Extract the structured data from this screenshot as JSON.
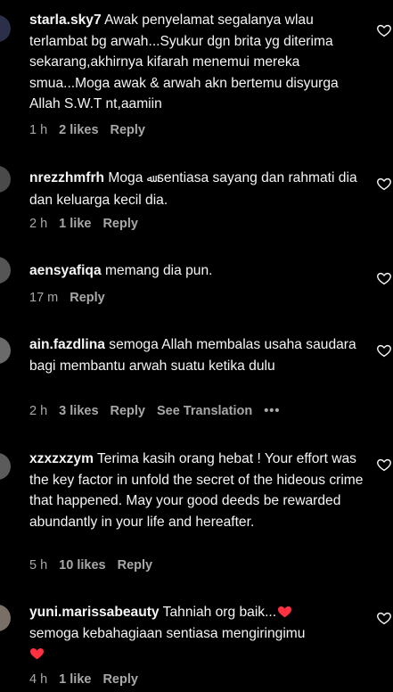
{
  "comments": [
    {
      "username": "starla.sky7",
      "text": "Awak penyelamat segalanya wlau terlambat bg arwah...Syukur dgn brita yg diterima sekarang,akhirnya kifarah menemui mereka smua...Moga awak & arwah akn bertemu disyurga Allah S.W.T nt,aamiin",
      "time": "1 h",
      "likes": "2 likes",
      "reply": "Reply"
    },
    {
      "username": "nrezzhmfrh",
      "text_before": "Moga ",
      "allah_glyph": "ﷲ",
      "text_after": " sentiasa sayang dan rahmati dia dan keluarga kecil dia.",
      "time": "2 h",
      "likes": "1 like",
      "reply": "Reply"
    },
    {
      "username": "aensyafiqa",
      "text": "memang dia pun.",
      "time": "17 m",
      "reply": "Reply"
    },
    {
      "username": "ain.fazdlina",
      "text": "semoga Allah membalas usaha saudara bagi membantu arwah suatu ketika dulu",
      "time": "2 h",
      "likes": "3 likes",
      "reply": "Reply",
      "see_translation": "See Translation",
      "more": "•••"
    },
    {
      "username": "xzxzxzym",
      "text": "Terima kasih orang hebat ! Your effort was the key factor in unfold the secret of the hideous crime that happened. May your good deeds be rewarded abundantly in your life and hereafter.",
      "time": "5 h",
      "likes": "10 likes",
      "reply": "Reply"
    },
    {
      "username": "yuni.marissabeauty",
      "text_before": "Tahniah org baik...",
      "text_middle": "semoga kebahagiaan sentiasa mengiringimu",
      "time": "4 h",
      "likes": "1 like",
      "reply": "Reply"
    }
  ],
  "colors": {
    "background": "#000000",
    "text": "#f5f5f5",
    "meta": "#a8a8a8",
    "heart_emoji": "#ff3040"
  },
  "icons": {
    "like": "heart-outline-icon",
    "emoji": "red-heart-emoji"
  }
}
